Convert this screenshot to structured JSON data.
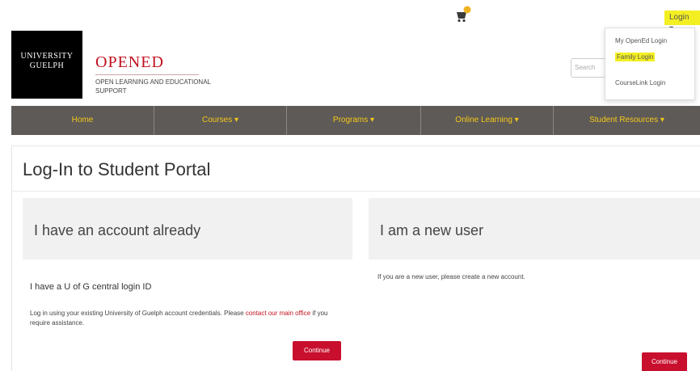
{
  "header": {
    "cart_icon": "cart-icon",
    "login_label": "Login",
    "login_caret": "▾",
    "search_placeholder": "Search",
    "login_menu": {
      "items": [
        {
          "label": "My OpenEd Login"
        },
        {
          "label": "Family Login"
        },
        {
          "label": "CourseLink Login"
        }
      ],
      "highlight_color": "#f4ef22"
    }
  },
  "brand": {
    "logo_line1": "UNIVERSITY",
    "logo_line2": "GUELPH",
    "name": "OPENED",
    "tagline": "OPEN LEARNING AND EDUCATIONAL SUPPORT"
  },
  "nav": {
    "items": [
      {
        "label": "Home"
      },
      {
        "label": "Courses ▾"
      },
      {
        "label": "Programs ▾"
      },
      {
        "label": "Online Learning ▾"
      },
      {
        "label": "Student Resources ▾"
      }
    ]
  },
  "main": {
    "title": "Log-In to Student Portal",
    "existing": {
      "heading": "I have an account already",
      "subheading": "I have a U of G central login ID",
      "text_before": "Log in using your existing University of Guelph account credentials. Please ",
      "link_text": "contact our main office",
      "text_after": " if you require assistance.",
      "button": "Continue"
    },
    "new_user": {
      "heading": "I am a new user",
      "text": "If you are a new user, please create a new account.",
      "button": "Continue"
    }
  },
  "colors": {
    "brand_red": "#c1121f",
    "button_red": "#c8102e",
    "nav_bg": "#5e5a57",
    "nav_text": "#f5c91b",
    "panel_bg": "#f1f1f1"
  }
}
